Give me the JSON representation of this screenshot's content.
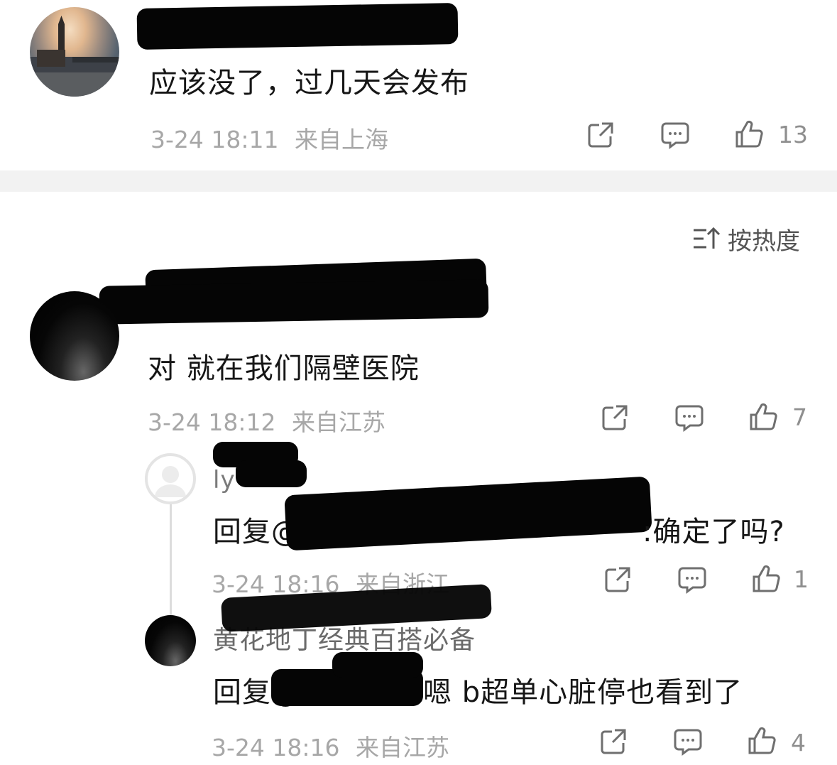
{
  "comments": [
    {
      "text": "应该没了，过几天会发布",
      "time": "3-24 18:11",
      "location": "来自上海",
      "likes": "13",
      "avatar": "landmark-photo"
    },
    {
      "text": "对 就在我们隔壁医院",
      "time": "3-24 18:12",
      "location": "来自江苏",
      "likes": "7",
      "avatar": "dark-photo"
    }
  ],
  "sort": {
    "label": "按热度",
    "icon": "sort-icon"
  },
  "replies": [
    {
      "username_partial": "ly",
      "text_prefix": "回复@",
      "text_suffix": ":确定了吗?",
      "time": "3-24 18:16",
      "location": "来自浙江",
      "likes": "1",
      "avatar": "default-avatar"
    },
    {
      "username": "黄花地丁经典百搭必备",
      "text_prefix": "回复@",
      "text_suffix": "嗯 b超单心脏停也看到了",
      "time": "3-24 18:16",
      "location": "来自江苏",
      "likes": "4",
      "avatar": "dark-photo"
    }
  ],
  "colors": {
    "meta": "#a7a7a7",
    "divider": "#f2f2f2",
    "text": "#161616"
  }
}
